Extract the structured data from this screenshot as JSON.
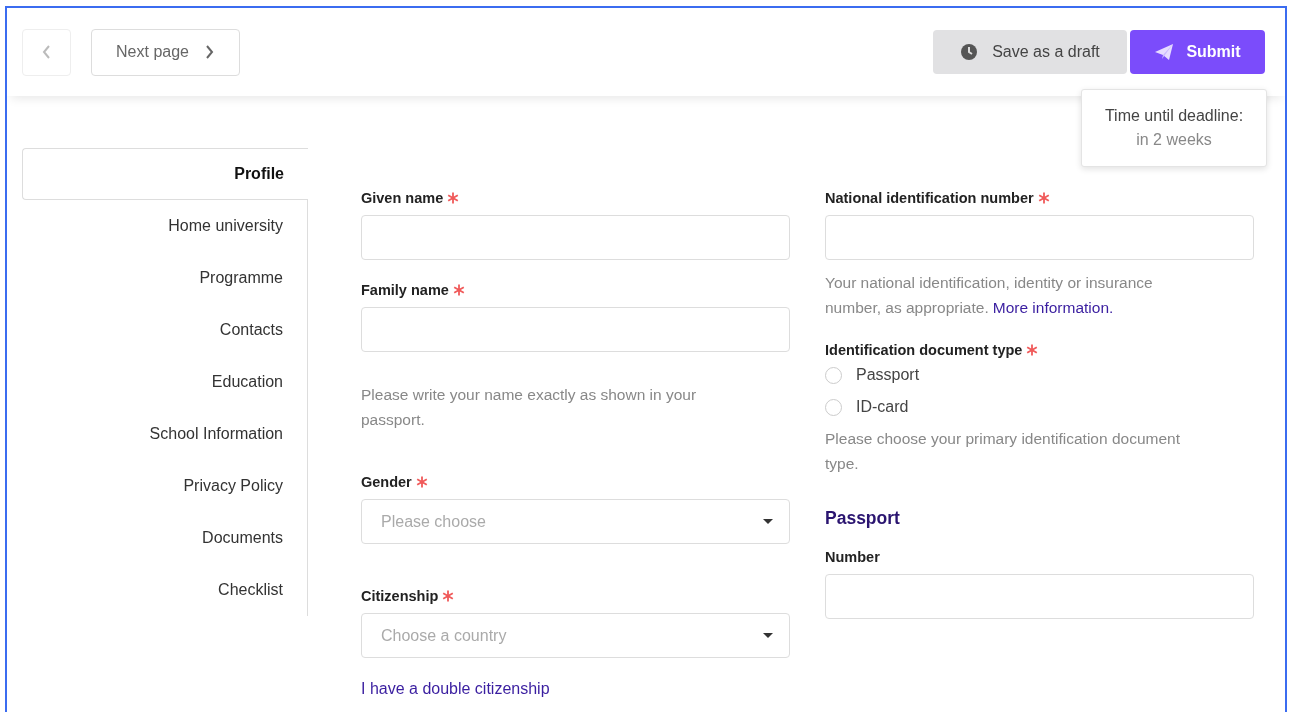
{
  "toolbar": {
    "prev_button": {
      "disabled": true
    },
    "next_button": {
      "label": "Next page"
    },
    "draft_button": {
      "label": "Save as a draft"
    },
    "submit_button": {
      "label": "Submit"
    },
    "tooltip": {
      "title": "Time until deadline:",
      "value": "in 2 weeks"
    }
  },
  "sidebar": {
    "items": [
      {
        "label": "Profile",
        "selected": true
      },
      {
        "label": "Home university",
        "selected": false
      },
      {
        "label": "Programme",
        "selected": false
      },
      {
        "label": "Contacts",
        "selected": false
      },
      {
        "label": "Education",
        "selected": false
      },
      {
        "label": "School Information",
        "selected": false
      },
      {
        "label": "Privacy Policy",
        "selected": false
      },
      {
        "label": "Documents",
        "selected": false
      },
      {
        "label": "Checklist",
        "selected": false
      }
    ]
  },
  "form": {
    "left_column": [
      {
        "kind": "text",
        "label": "Given name",
        "required": true
      },
      {
        "kind": "text",
        "label": "Family name",
        "required": true
      },
      {
        "kind": "help",
        "text": "Please write your name exactly as shown in your passport."
      },
      {
        "kind": "select",
        "label": "Gender",
        "required": true,
        "placeholder": "Please choose"
      },
      {
        "kind": "select",
        "label": "Citizenship",
        "required": true,
        "placeholder": "Choose a country"
      },
      {
        "kind": "link",
        "text": "I have a double citizenship"
      }
    ],
    "right_column": [
      {
        "kind": "text",
        "label": "National identification number",
        "required": true
      },
      {
        "kind": "help",
        "text": "Your national identification, identity or insurance number, as appropriate.",
        "link": "More information."
      },
      {
        "kind": "radio",
        "label": "Identification document type",
        "required": true,
        "options": [
          {
            "label": "Passport",
            "selected": false
          },
          {
            "label": "ID-card",
            "selected": false
          }
        ]
      },
      {
        "kind": "help",
        "text": "Please choose your primary identification document type."
      },
      {
        "kind": "heading",
        "text": "Passport"
      },
      {
        "kind": "text",
        "label": "Number"
      }
    ]
  }
}
